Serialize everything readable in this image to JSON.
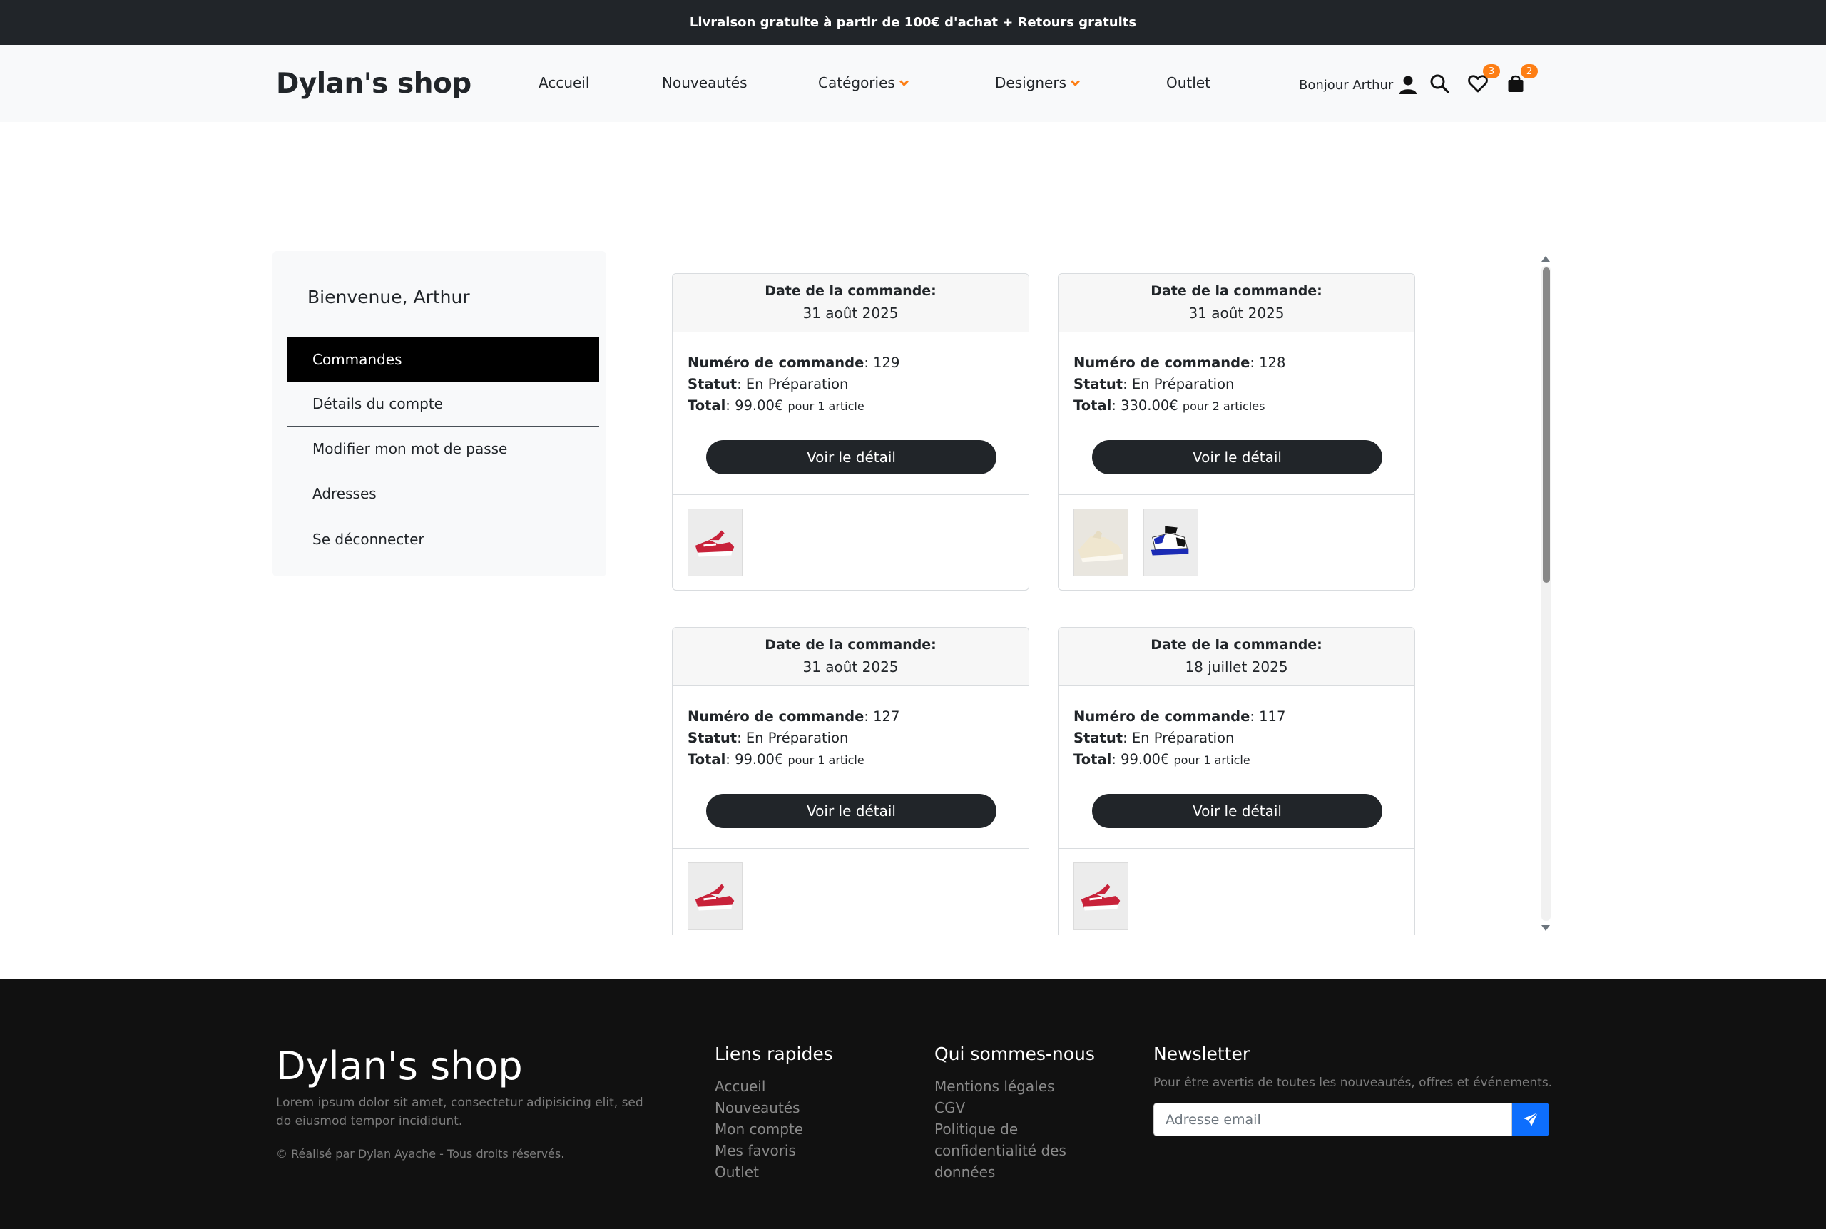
{
  "announcement": "Livraison gratuite à partir de 100€ d'achat + Retours gratuits",
  "header": {
    "brand": "Dylan's shop",
    "nav": [
      {
        "label": "Accueil"
      },
      {
        "label": "Nouveautés"
      },
      {
        "label": "Catégories",
        "dropdown": true
      },
      {
        "label": "Designers",
        "dropdown": true
      },
      {
        "label": "Outlet"
      }
    ],
    "greeting": "Bonjour Arthur",
    "wishlist_count": "3",
    "cart_count": "2",
    "icons": [
      "user-icon",
      "search-icon",
      "heart-icon",
      "shopping-bag-icon"
    ],
    "accent_color": "#fd7e14"
  },
  "sidebar": {
    "welcome": "Bienvenue, Arthur",
    "items": [
      {
        "label": "Commandes",
        "active": true
      },
      {
        "label": "Détails du compte"
      },
      {
        "label": "Modifier mon mot de passe"
      },
      {
        "label": "Adresses"
      },
      {
        "label": "Se déconnecter"
      }
    ]
  },
  "orders": {
    "labels": {
      "date": "Date de la commande:",
      "number": "Numéro de commande",
      "status": "Statut",
      "total": "Total",
      "button": "Voir le détail"
    },
    "items": [
      {
        "date": "31 août 2025",
        "number": "129",
        "status": "En Préparation",
        "total": "99.00€",
        "count_text": "pour 1 article",
        "thumbnails": [
          "red-sneaker"
        ]
      },
      {
        "date": "31 août 2025",
        "number": "128",
        "status": "En Préparation",
        "total": "330.00€",
        "count_text": "pour 2 articles",
        "thumbnails": [
          "cream-sneaker",
          "blue-sneaker"
        ]
      },
      {
        "date": "31 août 2025",
        "number": "127",
        "status": "En Préparation",
        "total": "99.00€",
        "count_text": "pour 1 article",
        "thumbnails": [
          "red-sneaker"
        ]
      },
      {
        "date": "18 juillet 2025",
        "number": "117",
        "status": "En Préparation",
        "total": "99.00€",
        "count_text": "pour 1 article",
        "thumbnails": [
          "red-sneaker"
        ]
      }
    ]
  },
  "footer": {
    "brand": "Dylan's shop",
    "description": "Lorem ipsum dolor sit amet, consectetur adipisicing elit, sed do eiusmod tempor incididunt.",
    "copyright": "© Réalisé par Dylan Ayache - Tous droits réservés.",
    "quick_links": {
      "title": "Liens rapides",
      "links": [
        "Accueil",
        "Nouveautés",
        "Mon compte",
        "Mes favoris",
        "Outlet"
      ]
    },
    "about": {
      "title": "Qui sommes-nous",
      "links": [
        "Mentions légales",
        "CGV",
        "Politique de",
        "confidentialité des",
        "données"
      ]
    },
    "newsletter": {
      "title": "Newsletter",
      "note": "Pour être avertis de toutes les nouveautés, offres et événements.",
      "placeholder": "Adresse email",
      "button_color": "#0d6efd"
    }
  }
}
